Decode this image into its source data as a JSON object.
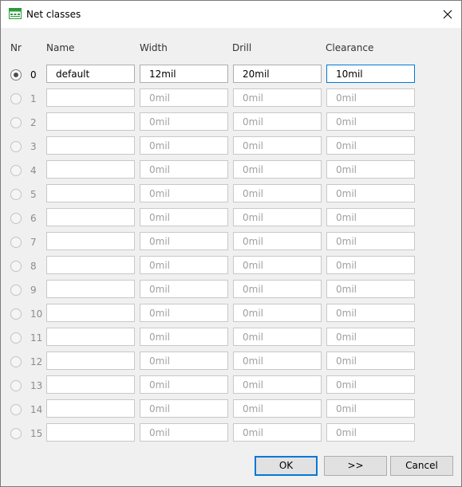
{
  "window": {
    "title": "Net classes"
  },
  "headers": {
    "nr": "Nr",
    "name": "Name",
    "width": "Width",
    "drill": "Drill",
    "clearance": "Clearance"
  },
  "rows": [
    {
      "nr": "0",
      "name": "default",
      "width": "12mil",
      "drill": "20mil",
      "clearance": "10mil",
      "selected": true
    },
    {
      "nr": "1",
      "name": "",
      "width": "0mil",
      "drill": "0mil",
      "clearance": "0mil",
      "selected": false
    },
    {
      "nr": "2",
      "name": "",
      "width": "0mil",
      "drill": "0mil",
      "clearance": "0mil",
      "selected": false
    },
    {
      "nr": "3",
      "name": "",
      "width": "0mil",
      "drill": "0mil",
      "clearance": "0mil",
      "selected": false
    },
    {
      "nr": "4",
      "name": "",
      "width": "0mil",
      "drill": "0mil",
      "clearance": "0mil",
      "selected": false
    },
    {
      "nr": "5",
      "name": "",
      "width": "0mil",
      "drill": "0mil",
      "clearance": "0mil",
      "selected": false
    },
    {
      "nr": "6",
      "name": "",
      "width": "0mil",
      "drill": "0mil",
      "clearance": "0mil",
      "selected": false
    },
    {
      "nr": "7",
      "name": "",
      "width": "0mil",
      "drill": "0mil",
      "clearance": "0mil",
      "selected": false
    },
    {
      "nr": "8",
      "name": "",
      "width": "0mil",
      "drill": "0mil",
      "clearance": "0mil",
      "selected": false
    },
    {
      "nr": "9",
      "name": "",
      "width": "0mil",
      "drill": "0mil",
      "clearance": "0mil",
      "selected": false
    },
    {
      "nr": "10",
      "name": "",
      "width": "0mil",
      "drill": "0mil",
      "clearance": "0mil",
      "selected": false
    },
    {
      "nr": "11",
      "name": "",
      "width": "0mil",
      "drill": "0mil",
      "clearance": "0mil",
      "selected": false
    },
    {
      "nr": "12",
      "name": "",
      "width": "0mil",
      "drill": "0mil",
      "clearance": "0mil",
      "selected": false
    },
    {
      "nr": "13",
      "name": "",
      "width": "0mil",
      "drill": "0mil",
      "clearance": "0mil",
      "selected": false
    },
    {
      "nr": "14",
      "name": "",
      "width": "0mil",
      "drill": "0mil",
      "clearance": "0mil",
      "selected": false
    },
    {
      "nr": "15",
      "name": "",
      "width": "0mil",
      "drill": "0mil",
      "clearance": "0mil",
      "selected": false
    }
  ],
  "buttons": {
    "ok": "OK",
    "next": ">>",
    "cancel": "Cancel"
  },
  "icons": {
    "title": "net-classes-app-icon",
    "close": "close-icon"
  },
  "colors": {
    "focus_border": "#0078d7",
    "dialog_bg": "#f0f0f0",
    "button_bg": "#e1e1e1",
    "app_icon_green": "#2e9b3a"
  }
}
